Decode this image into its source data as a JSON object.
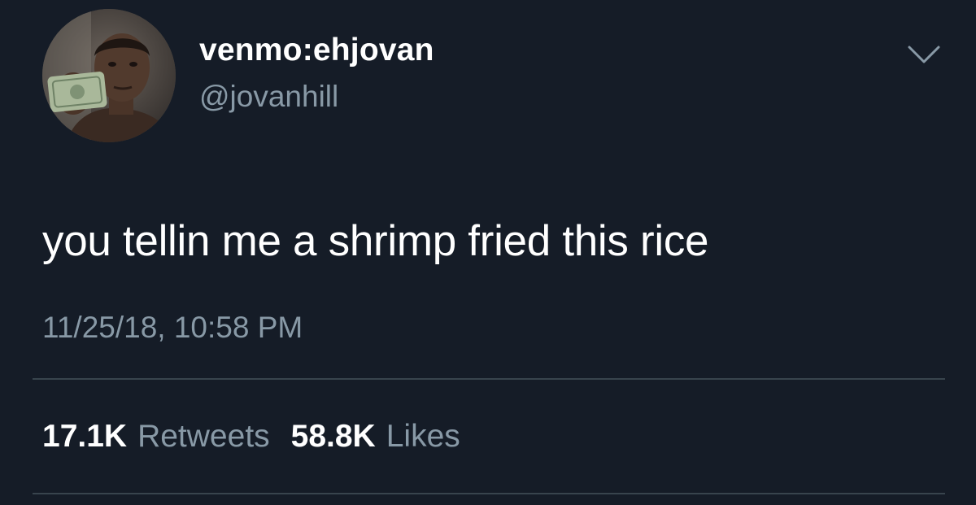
{
  "tweet": {
    "author": {
      "display_name": "venmo:ehjovan",
      "handle": "@jovanhill"
    },
    "text": "you tellin me a shrimp fried this rice",
    "timestamp": "11/25/18, 10:58 PM",
    "stats": {
      "retweets_count": "17.1K",
      "retweets_label": "Retweets",
      "likes_count": "58.8K",
      "likes_label": "Likes"
    }
  },
  "icons": {
    "menu": "chevron-down-icon"
  },
  "colors": {
    "background": "#151c27",
    "primary_text": "#ffffff",
    "secondary_text": "#8899a6",
    "divider": "#38444d"
  }
}
